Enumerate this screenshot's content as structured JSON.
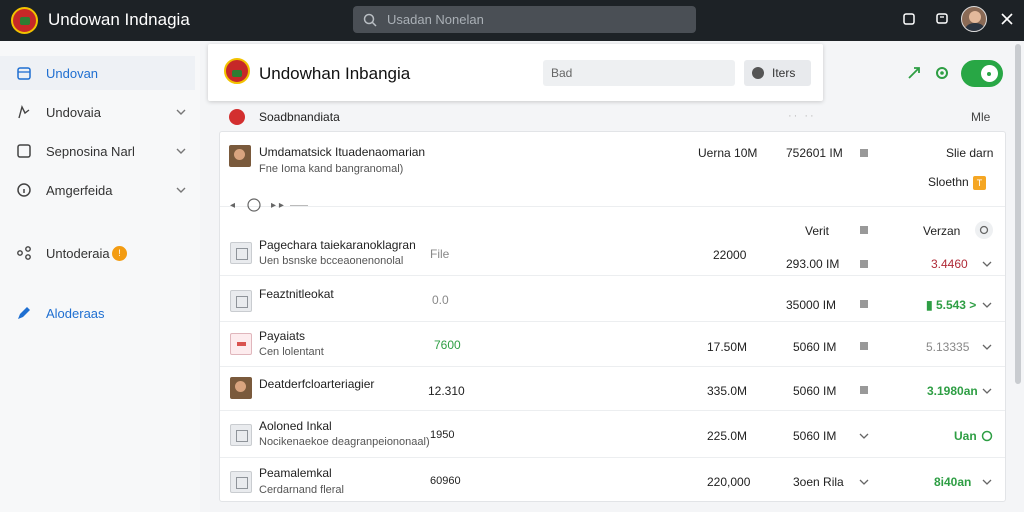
{
  "app": {
    "title": "Undowan Indnagia"
  },
  "search": {
    "placeholder": "Usadan Nonelan"
  },
  "sidebar": {
    "items": [
      {
        "label": "Undovan",
        "icon": "calendar-icon"
      },
      {
        "label": "Undovaia",
        "icon": "user-icon"
      },
      {
        "label": "Sepnosina Narl",
        "icon": "square-icon"
      },
      {
        "label": "Amgerfeida",
        "icon": "info-icon"
      },
      {
        "label": "Untoderaia",
        "icon": "share-icon",
        "badge": "!"
      },
      {
        "label": "Aloderaas",
        "icon": "edit-icon"
      }
    ]
  },
  "header": {
    "title": "Undowhan Inbangia",
    "input_value": "Bad",
    "button_label": "Iters"
  },
  "section": {
    "title": "Soadbnandiata",
    "mid": "·· ··",
    "right": "Mle"
  },
  "top_row": {
    "name": "Umdamatsick Ituadenaomarian",
    "sub": "Fne Ioma kand bangranomal)",
    "size": "Uerna 10M",
    "size2": "752601 IM",
    "status": "Slie darn",
    "status2": "Sloethn",
    "tag": "T"
  },
  "columns": {
    "col1": "Verit",
    "col2": "Verzan"
  },
  "rows": [
    {
      "name": "Pagechara taiekaranoklagran",
      "sub": "Uen bsnske bcceaonenonolal",
      "type": "File",
      "amount": "22000",
      "size": "293.00 IM",
      "value": "3.4460"
    },
    {
      "name": "Feaztnitleokat",
      "sub": "",
      "type": "0.0",
      "amount": "",
      "size": "35000 IM",
      "value": "▮ 5.543 >"
    },
    {
      "name": "Payaiats",
      "sub": "Cen lolentant",
      "type": "7600",
      "amount": "17.50M",
      "size": "5060 IM",
      "value": "5.13335"
    },
    {
      "name": "Deatderfcloarteriagier",
      "sub": "",
      "type": "12.310",
      "amount": "335.0M",
      "size": "5060 IM",
      "value": "3.1980an"
    },
    {
      "name": "Aoloned Inkal",
      "sub": "Nocikenaekoe deagranpeiononaal)",
      "type": "1950",
      "amount": "225.0M",
      "size": "5060 IM",
      "value": "Uan"
    },
    {
      "name": "Peamalemkal",
      "sub": "Cerdarnand fleral",
      "type": "60960",
      "amount": "220,000",
      "size": "3oen Rila",
      "value": "8i40an"
    }
  ]
}
